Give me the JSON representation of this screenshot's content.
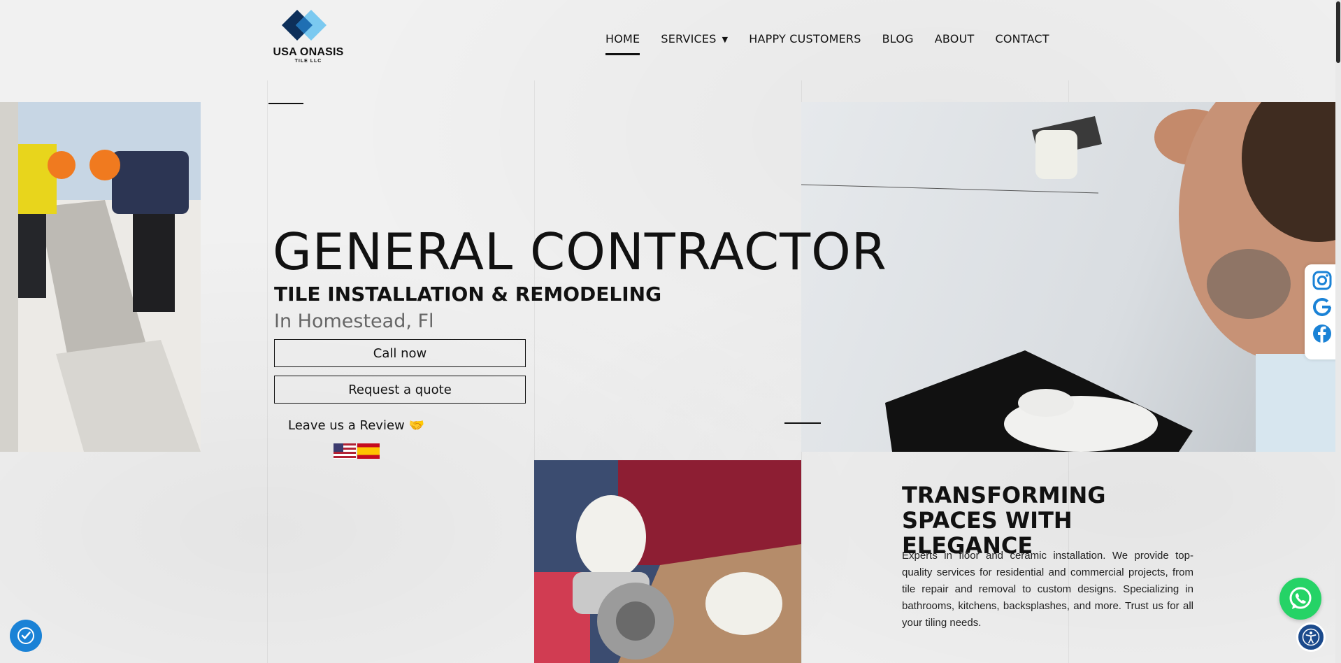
{
  "logo": {
    "name": "USA ONASIS",
    "sub": "TILE LLC"
  },
  "nav": {
    "items": [
      {
        "label": "HOME",
        "active": true
      },
      {
        "label": "SERVICES",
        "dropdown": true
      },
      {
        "label": "HAPPY CUSTOMERS"
      },
      {
        "label": "BLOG"
      },
      {
        "label": "ABOUT"
      },
      {
        "label": "CONTACT"
      }
    ]
  },
  "hero": {
    "title": "GENERAL CONTRACTOR",
    "subtitle": "TILE INSTALLATION & REMODELING",
    "location": "In Homestead, Fl",
    "call_label": "Call now",
    "quote_label": "Request a quote",
    "review_label": "Leave us a Review 🤝"
  },
  "section": {
    "title": "TRANSFORMING SPACES WITH ELEGANCE",
    "text": "Experts in floor and ceramic installation. We provide top-quality services for residential and commercial projects, from tile repair and removal to custom designs. Specializing in bathrooms, kitchens, backsplashes, and more. Trust us for all your tiling needs."
  },
  "icons": {
    "social": [
      "instagram-icon",
      "google-icon",
      "facebook-icon"
    ],
    "floating": [
      "whatsapp-icon",
      "accessibility-icon",
      "cookie-consent-icon"
    ]
  },
  "colors": {
    "accent": "#111111",
    "social_blue": "#1a82d6",
    "whatsapp": "#25d366"
  }
}
